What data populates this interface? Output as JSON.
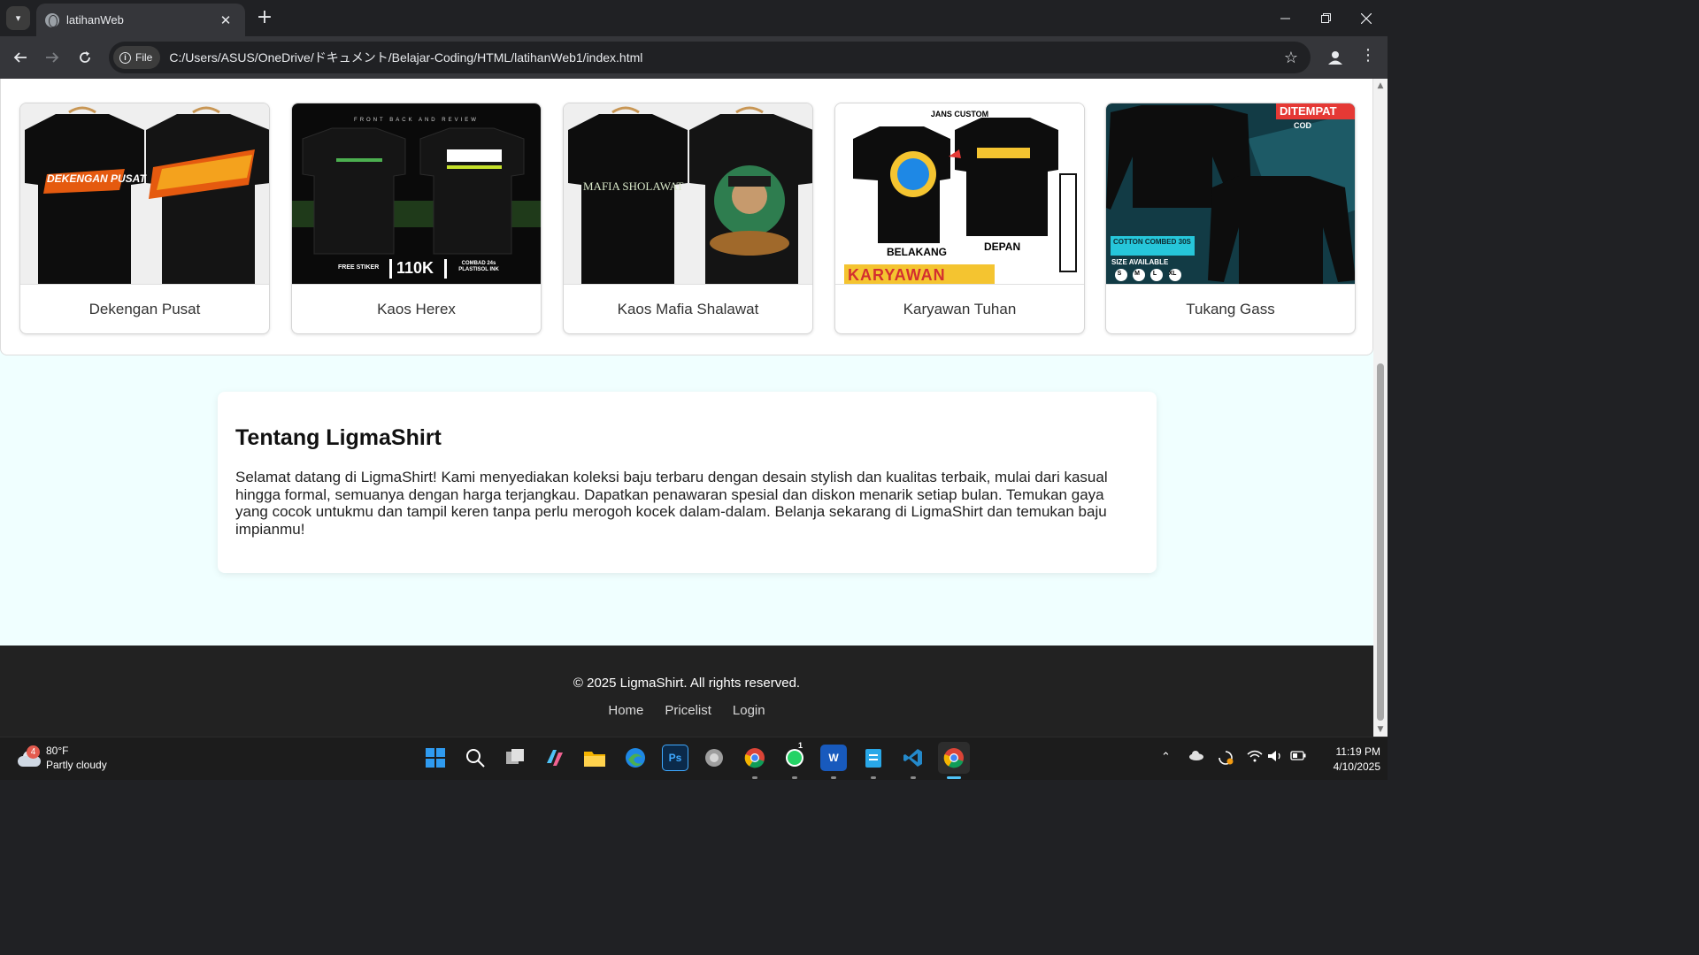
{
  "browser": {
    "tab_title": "latihanWeb",
    "close_glyph": "✕",
    "new_tab_glyph": "+",
    "scheme_chip": "File",
    "url": "C:/Users/ASUS/OneDrive/ドキュメント/Belajar-Coding/HTML/latihanWeb1/index.html"
  },
  "products": [
    {
      "name": "Dekengan Pusat",
      "thumb_text": "DEKENGAN PUSAT"
    },
    {
      "name": "Kaos Herex",
      "thumb_text": "110K"
    },
    {
      "name": "Kaos Mafia Shalawat",
      "thumb_text": "MAFIA SHOLAWAT"
    },
    {
      "name": "Karyawan Tuhan",
      "thumb_text": "KARYAWAN"
    },
    {
      "name": "Tukang Gass",
      "thumb_text": "DITEMPAT"
    }
  ],
  "thumbs": {
    "herex_header": "FRONT BACK AND REVIEW",
    "herex_sticker": "FREE STIKER",
    "herex_material": "COMBAD 24s PLASTISOL INK",
    "karyawan_brand": "JANS CUSTOM",
    "karyawan_back": "BELAKANG",
    "karyawan_front": "DEPAN",
    "tukang_cod": "COD",
    "tukang_cotton": "COTTON COMBED 30S",
    "tukang_size": "SIZE AVAILABLE",
    "tukang_sizes": [
      "S",
      "M",
      "L",
      "XL"
    ]
  },
  "about": {
    "title": "Tentang LigmaShirt",
    "body": "Selamat datang di LigmaShirt! Kami menyediakan koleksi baju terbaru dengan desain stylish dan kualitas terbaik, mulai dari kasual hingga formal, semuanya dengan harga terjangkau. Dapatkan penawaran spesial dan diskon menarik setiap bulan. Temukan gaya yang cocok untukmu dan tampil keren tanpa perlu merogoh kocek dalam-dalam. Belanja sekarang di LigmaShirt dan temukan baju impianmu!"
  },
  "footer": {
    "copyright": "© 2025 LigmaShirt. All rights reserved.",
    "links": [
      "Home",
      "Pricelist",
      "Login"
    ]
  },
  "taskbar": {
    "weather_badge": "4",
    "temperature": "80°F",
    "condition": "Partly cloudy",
    "time": "11:19 PM",
    "date": "4/10/2025",
    "apps": [
      "start-icon",
      "search-icon",
      "task-view-icon",
      "copilot-icon",
      "file-explorer-icon",
      "edge-icon",
      "photoshop-icon",
      "app-icon",
      "chrome-icon",
      "whatsapp-icon",
      "word-icon",
      "notepad-icon",
      "vscode-icon",
      "chrome-active-icon"
    ],
    "photoshop_label": "Ps",
    "word_label": "W",
    "whatsapp_badge": "1"
  },
  "colors": {
    "page_bg": "#f0ffff",
    "footer_bg": "#222222",
    "accent_red": "#e53935"
  }
}
